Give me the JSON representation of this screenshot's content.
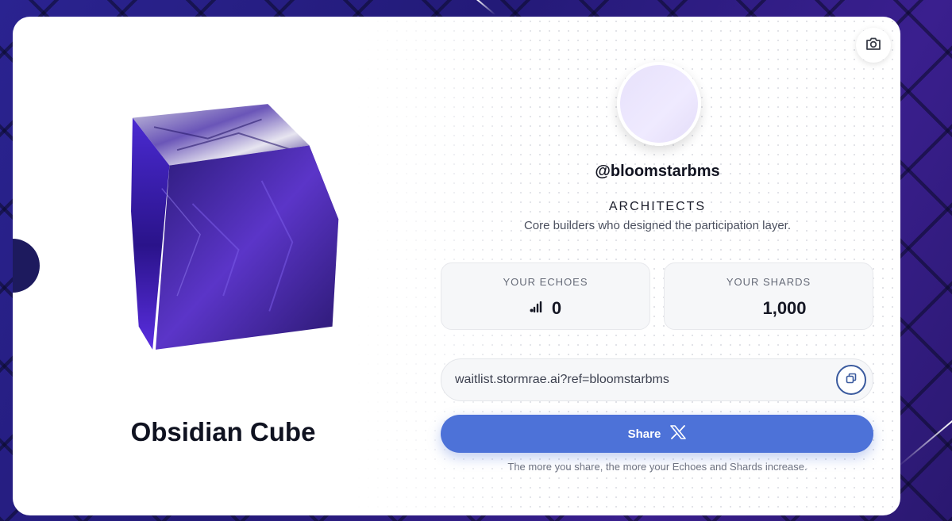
{
  "item": {
    "name": "Obsidian Cube",
    "image_icon": "obsidian-cube-image"
  },
  "profile": {
    "username": "@bloomstarbms",
    "role": "ARCHITECTS",
    "role_description": "Core builders who designed the participation layer."
  },
  "stats": {
    "echoes_label": "YOUR ECHOES",
    "echoes_value": "0",
    "echoes_icon": "signal-bars-icon",
    "shards_label": "YOUR SHARDS",
    "shards_value": "1,000"
  },
  "referral": {
    "link": "waitlist.stormrae.ai?ref=bloomstarbms",
    "copy_icon": "copy-icon"
  },
  "share": {
    "label": "Share",
    "icon": "x-logo-icon",
    "hint": "The more you share, the more your Echoes and Shards increase."
  },
  "toolbar": {
    "camera_icon": "camera-icon"
  },
  "colors": {
    "accent": "#4d72d8",
    "background": "#231a78",
    "card": "#ffffff"
  }
}
